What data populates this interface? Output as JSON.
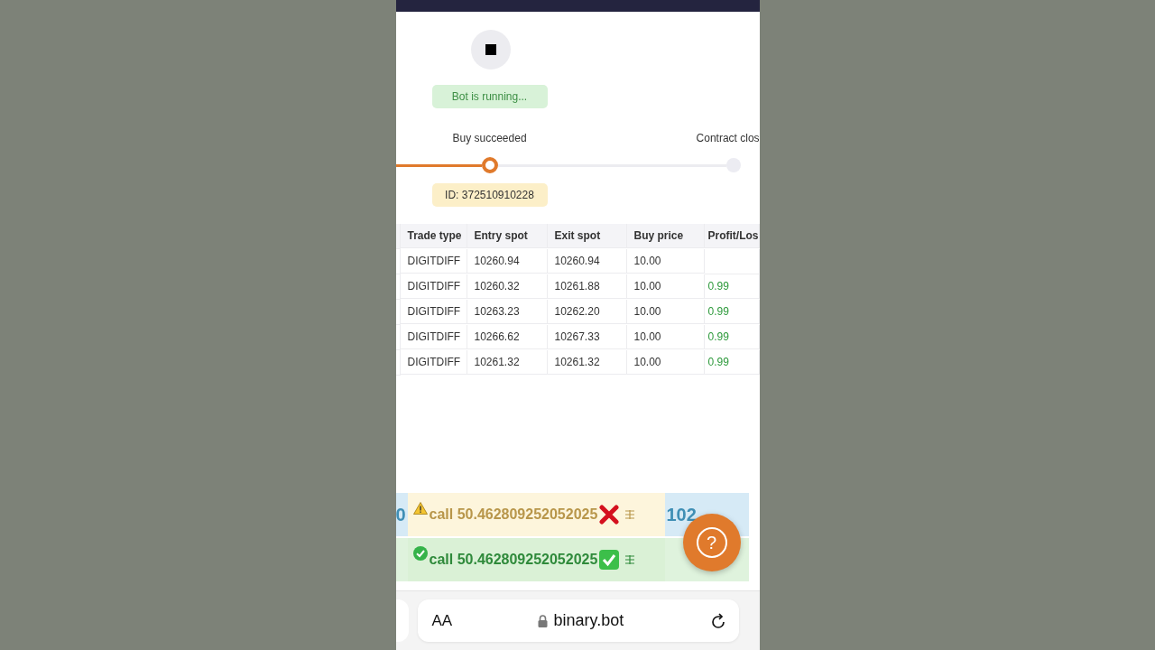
{
  "status": "Bot is running...",
  "steps": [
    {
      "label": "Buy succeeded",
      "selected": true
    },
    {
      "label": "Contract clos",
      "selected": false
    }
  ],
  "contract_id": "ID: 372510910228",
  "table": {
    "columns": [
      "Trade type",
      "Entry spot",
      "Exit spot",
      "Buy price",
      "Profit/Los"
    ],
    "rows": [
      {
        "trade_type": "DIGITDIFF",
        "entry_spot": "10260.94",
        "exit_spot": "10260.94",
        "buy_price": "10.00"
      },
      {
        "trade_type": "DIGITDIFF",
        "entry_spot": "10260.32",
        "exit_spot": "10261.88",
        "buy_price": "10.00",
        "profit_loss": "0.99"
      },
      {
        "trade_type": "DIGITDIFF",
        "entry_spot": "10263.23",
        "exit_spot": "10262.20",
        "buy_price": "10.00",
        "profit_loss": "0.99"
      },
      {
        "trade_type": "DIGITDIFF",
        "entry_spot": "10266.62",
        "exit_spot": "10267.33",
        "buy_price": "10.00",
        "profit_loss": "0.99"
      },
      {
        "trade_type": "DIGITDIFF",
        "entry_spot": "10261.32",
        "exit_spot": "10261.32",
        "buy_price": "10.00",
        "profit_loss": "0.99"
      }
    ]
  },
  "notifications": [
    {
      "kind": "warning",
      "before": "0",
      "text": "call 50.462809252052025",
      "after": "102"
    },
    {
      "kind": "success",
      "text": "call 50.462809252052025"
    }
  ],
  "help_button": {
    "label": "?"
  },
  "browser": {
    "text_size": "AA",
    "url": "binary.bot"
  }
}
